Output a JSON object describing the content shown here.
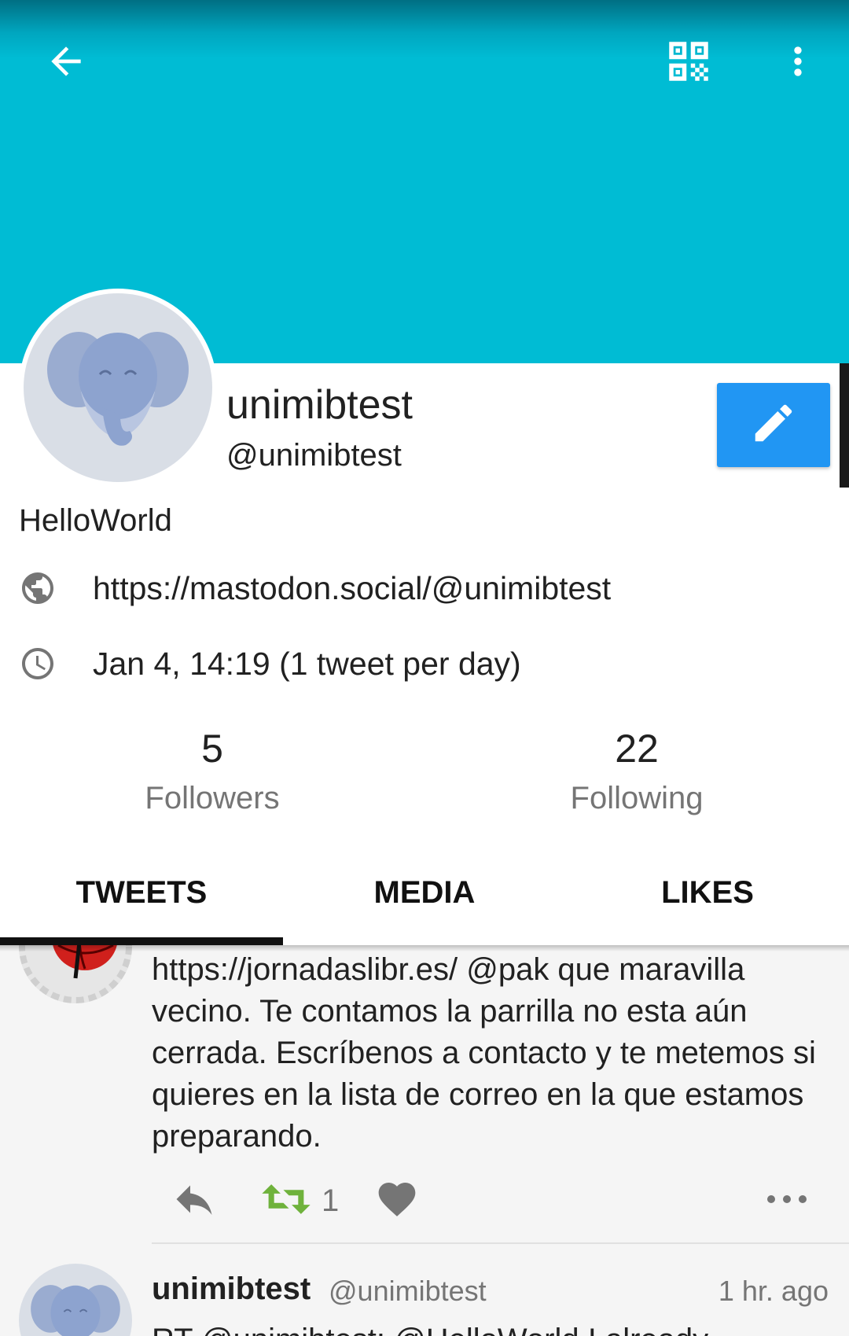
{
  "header": {
    "back_icon": "arrow-left-icon",
    "qr_icon": "qr-code-icon",
    "more_icon": "more-vert-icon",
    "colors": {
      "banner": "#00bcd4",
      "banner_top": "#006f83"
    }
  },
  "profile": {
    "display_name": "unimibtest",
    "handle": "@unimibtest",
    "bio": "HelloWorld",
    "url": "https://mastodon.social/@unimibtest",
    "joined": "Jan 4, 14:19 (1 tweet per day)",
    "edit_icon": "pencil-icon",
    "edit_color": "#2196f3"
  },
  "stats": {
    "followers_count": "5",
    "followers_label": "Followers",
    "following_count": "22",
    "following_label": "Following"
  },
  "tabs": [
    {
      "label": "TWEETS",
      "selected": true
    },
    {
      "label": "MEDIA",
      "selected": false
    },
    {
      "label": "LIKES",
      "selected": false
    }
  ],
  "feed": {
    "post1": {
      "text": "https://jornadaslibr.es/ @pak que maravilla vecino. Te contamos la parrilla no esta aún cerrada. Escríbenos a contacto y te metemos si quieres en la lista de correo en la que estamos preparando.",
      "boost_count": "1",
      "boost_color": "#6fb23c"
    },
    "post2": {
      "name": "unimibtest",
      "handle": "@unimibtest",
      "time": "1 hr. ago",
      "text": "RT @unimibtest: @HelloWorld I already"
    }
  }
}
